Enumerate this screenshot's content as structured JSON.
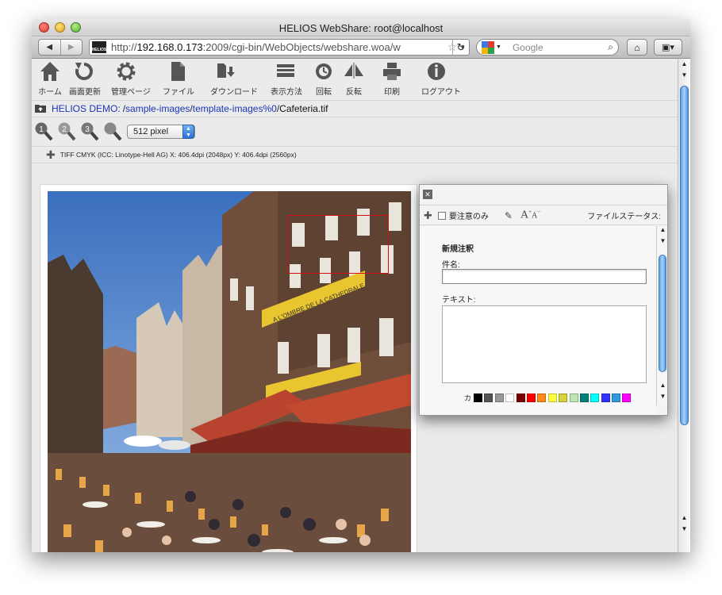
{
  "window": {
    "title": "HELIOS WebShare: root@localhost"
  },
  "browser": {
    "url_host": "192.168.0.173",
    "url_prefix": "http://",
    "url_rest": ":2009/cgi-bin/WebObjects/webshare.woa/w",
    "site_icon_text": "HELIOS",
    "search_placeholder": "Google"
  },
  "toolbar": {
    "items": [
      {
        "label": "ホーム",
        "icon": "home-icon"
      },
      {
        "label": "画面更新",
        "icon": "refresh-icon"
      },
      {
        "label": "管理ページ",
        "icon": "gear-icon"
      },
      {
        "label": "ファイル",
        "icon": "file-icon"
      },
      {
        "label": "ダウンロード",
        "icon": "download-icon"
      },
      {
        "label": "表示方法",
        "icon": "view-icon"
      },
      {
        "label": "回転",
        "icon": "rotate-icon"
      },
      {
        "label": "反転",
        "icon": "flip-icon"
      },
      {
        "label": "印刷",
        "icon": "printer-icon"
      },
      {
        "label": "ログアウト",
        "icon": "info-icon"
      }
    ]
  },
  "path": {
    "root": "HELIOS DEMO:",
    "sep": "/",
    "seg1": "sample-images",
    "seg2": "template-images%0",
    "file": "Cafeteria.tif"
  },
  "zoom": {
    "size_value": "512 pixel"
  },
  "info": {
    "text": "TIFF  CMYK (ICC: Linotype-Hell AG)   X:  406.4dpi (2048px)   Y:  406.4dpi (2560px)"
  },
  "annotation_panel": {
    "important_only_label": "要注意のみ",
    "file_status_label": "ファイルステータス:",
    "new_note_title": "新規注釈",
    "subject_label": "件名:",
    "text_label": "テキスト:",
    "color_label": "カ",
    "swatches": [
      "#000000",
      "#555555",
      "#999999",
      "#ffffff",
      "#7a0000",
      "#ff0000",
      "#ff8a1a",
      "#ffff44",
      "#d6d23a",
      "#bfe6b0",
      "#00807a",
      "#00ffff",
      "#3030ff",
      "#3399dd",
      "#ff00ff"
    ]
  }
}
